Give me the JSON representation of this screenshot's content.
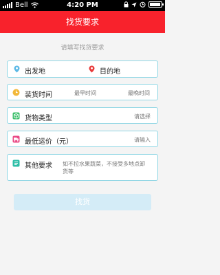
{
  "status_bar": {
    "carrier": "Bell",
    "time": "4:20 PM",
    "icons": [
      "signal-icon",
      "wifi-icon",
      "lock-icon",
      "location-icon",
      "alarm-icon",
      "battery-icon"
    ]
  },
  "nav": {
    "title": "找货要求"
  },
  "form": {
    "prompt": "请填写找货要求",
    "origin_label": "出发地",
    "destination_label": "目的地",
    "loading_time_label": "装货时间",
    "earliest_time": "最早时间",
    "latest_time": "最晚时间",
    "cargo_type_label": "货物类型",
    "cargo_type_hint": "请选择",
    "min_freight_label": "最低运价（元）",
    "min_freight_hint": "请输入",
    "other_label": "其他要求",
    "other_hint_line1": "如不拉水果蔬菜，不接受多地点卸",
    "other_hint_line2": "货等"
  },
  "submit_label": "找货",
  "colors": {
    "brand_red": "#f8222c",
    "border_blue": "#8fd6e4",
    "button_disabled": "#d4ecf7"
  }
}
